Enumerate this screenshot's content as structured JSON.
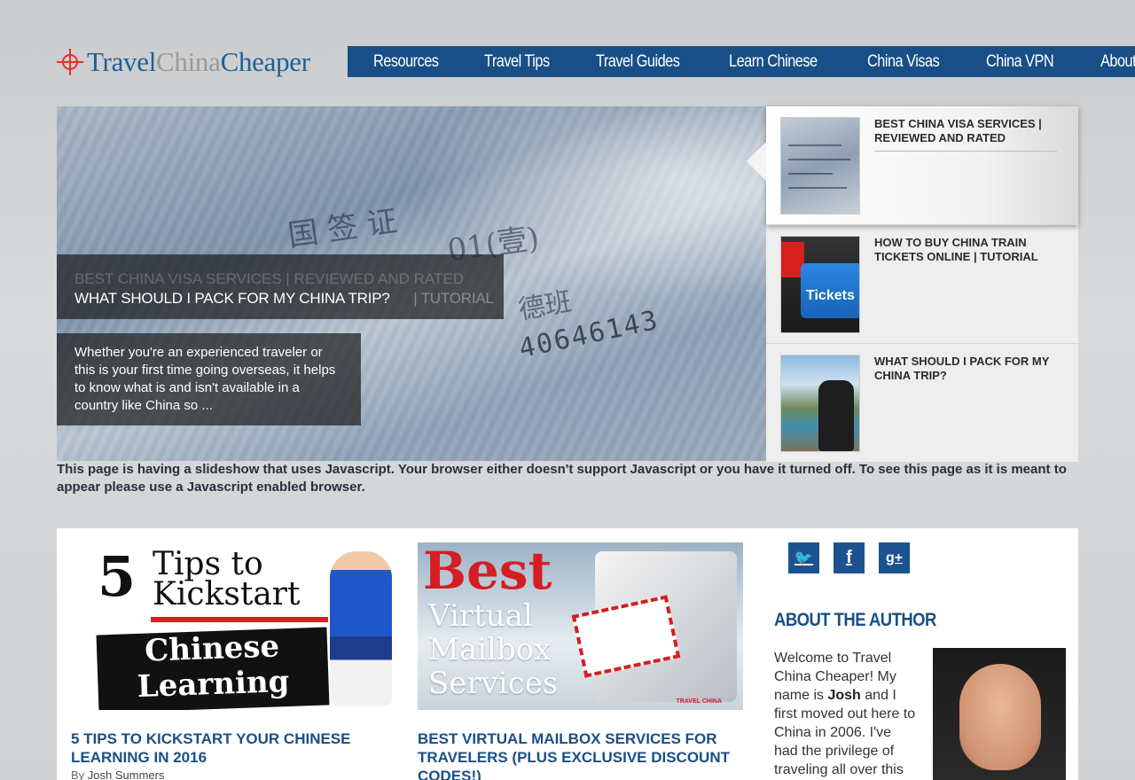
{
  "logo": {
    "part1": "Travel",
    "part2": "China",
    "part3": "Cheaper"
  },
  "nav": {
    "items": [
      "Resources",
      "Travel Tips",
      "Travel Guides",
      "Learn Chinese",
      "China Visas",
      "China VPN",
      "About"
    ],
    "background": "#174f86"
  },
  "slider": {
    "ghost_text": "BEST CHINA VISA SERVICES | REVIEWED AND RATED",
    "active_title": "WHAT SHOULD I PACK FOR MY CHINA TRIP?",
    "ghost_suffix": "| TUTORIAL",
    "description": "Whether you're an experienced traveler or this is your first time going overseas, it helps to know what is and isn't available in a country like China so ...",
    "items": [
      {
        "label": "BEST CHINA VISA SERVICES | REVIEWED AND RATED",
        "thumb": "passport-visa-image"
      },
      {
        "label": "HOW TO BUY CHINA TRAIN TICKETS ONLINE | TUTORIAL",
        "thumb": "tickets-keyboard-image"
      },
      {
        "label": "WHAT SHOULD I PACK FOR MY CHINA TRIP?",
        "thumb": "backpack-lake-image"
      }
    ]
  },
  "noscript": "This page is having a slideshow that uses Javascript. Your browser either doesn't support Javascript or you have it turned off. To see this page as it is meant to appear please use a Javascript enabled browser.",
  "posts": [
    {
      "title": "5 TIPS TO KICKSTART YOUR CHINESE LEARNING IN 2016",
      "byline_prefix": "By",
      "author": "Josh Summers",
      "image": {
        "line1": "5",
        "line2": "Tips to",
        "line3": "Kickstart",
        "line4": "Chinese",
        "line5": "Learning"
      }
    },
    {
      "title": "BEST VIRTUAL MAILBOX SERVICES FOR TRAVELERS (PLUS EXCLUSIVE DISCOUNT CODES!)",
      "image": {
        "line1": "Best",
        "line2": "Virtual",
        "line3": "Mailbox",
        "line4": "Services",
        "watermark": "TRAVEL CHINA"
      }
    }
  ],
  "social": [
    {
      "icon": "twitter-icon",
      "glyph": "🐦"
    },
    {
      "icon": "facebook-icon",
      "glyph": "f"
    },
    {
      "icon": "google-plus-icon",
      "glyph": "g+"
    }
  ],
  "author": {
    "heading": "ABOUT THE AUTHOR",
    "text_before": "Welcome to Travel China Cheaper! My name is",
    "name": "Josh",
    "text_after": "and I first moved out here to China in 2006. I've had the privilege of traveling all over this"
  },
  "colors": {
    "brand_blue": "#1a4f86",
    "accent_red": "#e2322a"
  }
}
